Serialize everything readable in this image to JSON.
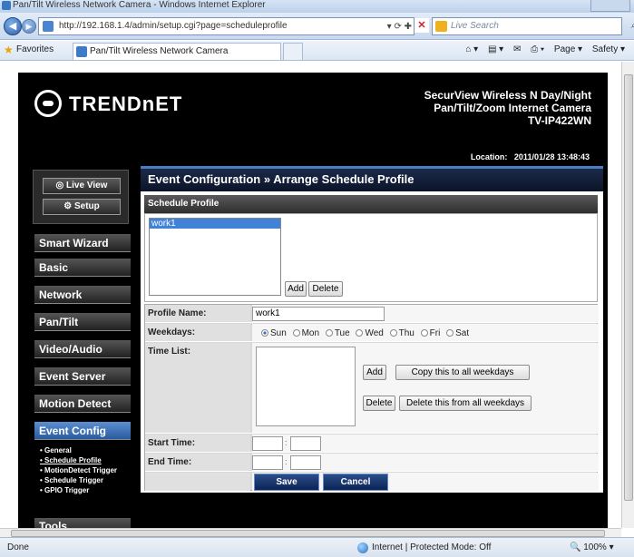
{
  "browser": {
    "window_title": "Pan/Tilt Wireless Network Camera - Windows Internet Explorer",
    "address": "http://192.168.1.4/admin/setup.cgi?page=scheduleprofile",
    "search_placeholder": "Live Search",
    "favorites_label": "Favorites",
    "tab_label": "Pan/Tilt Wireless Network Camera",
    "cmd_page": "Page ▾",
    "cmd_safety": "Safety ▾",
    "status_done": "Done",
    "status_zone": "Internet | Protected Mode: Off",
    "status_zoom": "100%"
  },
  "camera": {
    "brand": "TRENDnET",
    "product_line1": "SecurView Wireless N Day/Night",
    "product_line2": "Pan/Tilt/Zoom Internet Camera",
    "product_line3": "TV-IP422WN",
    "location_label": "Location:",
    "datetime": "2011/01/28 13:48:43"
  },
  "sidebar": {
    "live_view": "Live View",
    "setup": "Setup",
    "menu": [
      "Smart Wizard",
      "Basic",
      "Network",
      "Pan/Tilt",
      "Video/Audio",
      "Event Server",
      "Motion Detect",
      "Event Config"
    ],
    "submenu": [
      "• General",
      "• Schedule Profile",
      "• MotionDetect Trigger",
      "• Schedule Trigger",
      "• GPIO Trigger"
    ],
    "tools": "Tools"
  },
  "main": {
    "title": "Event Configuration » Arrange Schedule Profile",
    "schedule_profile_header": "Schedule Profile",
    "profiles": [
      "work1"
    ],
    "add_button": "Add",
    "delete_button": "Delete",
    "profile_name_label": "Profile Name:",
    "profile_name_value": "work1",
    "weekdays_label": "Weekdays:",
    "weekdays": [
      "Sun",
      "Mon",
      "Tue",
      "Wed",
      "Thu",
      "Fri",
      "Sat"
    ],
    "selected_weekday": "Sun",
    "time_list_label": "Time List:",
    "time_add": "Add",
    "copy_all": "Copy this to all weekdays",
    "time_delete": "Delete",
    "delete_all": "Delete this from all weekdays",
    "start_time_label": "Start Time:",
    "end_time_label": "End Time:",
    "time_separator": ":",
    "save_button": "Save",
    "cancel_button": "Cancel"
  }
}
